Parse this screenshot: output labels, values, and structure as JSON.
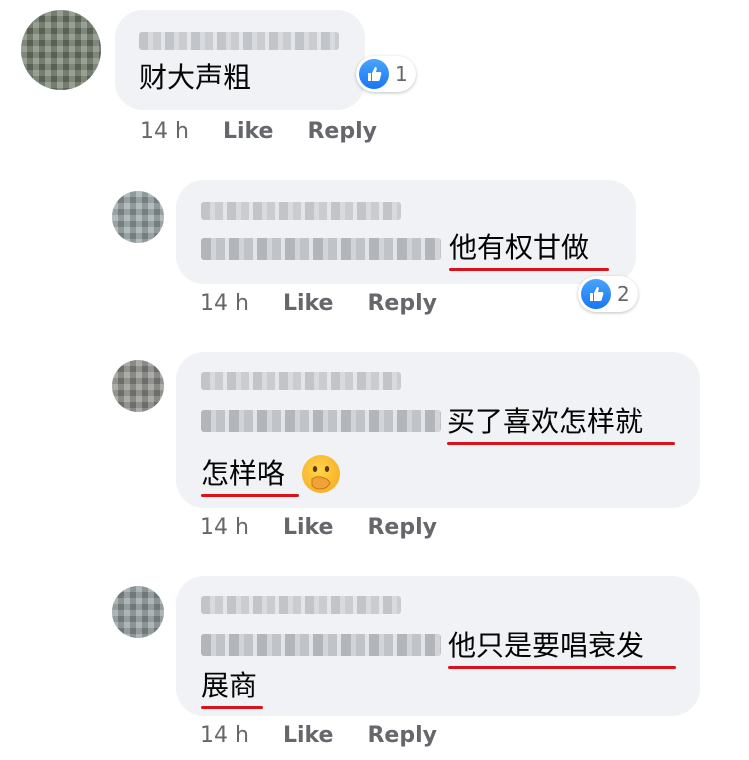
{
  "comments": [
    {
      "name_blurred": true,
      "text": "财大声粗",
      "reaction_count": "1",
      "time": "14 h",
      "like_label": "Like",
      "reply_label": "Reply"
    },
    {
      "name_blurred": true,
      "text": "他有权甘做",
      "reaction_count": "2",
      "time": "14 h",
      "like_label": "Like",
      "reply_label": "Reply"
    },
    {
      "name_blurred": true,
      "text_line1": "买了喜欢怎样就",
      "text_line2": "怎样咯",
      "emoji": "hand-over-mouth-emoji",
      "time": "14 h",
      "like_label": "Like",
      "reply_label": "Reply"
    },
    {
      "name_blurred": true,
      "text_line1": "他只是要唱衰发",
      "text_line2": "展商",
      "time": "14 h",
      "like_label": "Like",
      "reply_label": "Reply"
    }
  ],
  "colors": {
    "bubble": "#f0f2f5",
    "meta_text": "#65676b",
    "like_blue": "#1877f2",
    "underline_red": "#d9121b"
  }
}
